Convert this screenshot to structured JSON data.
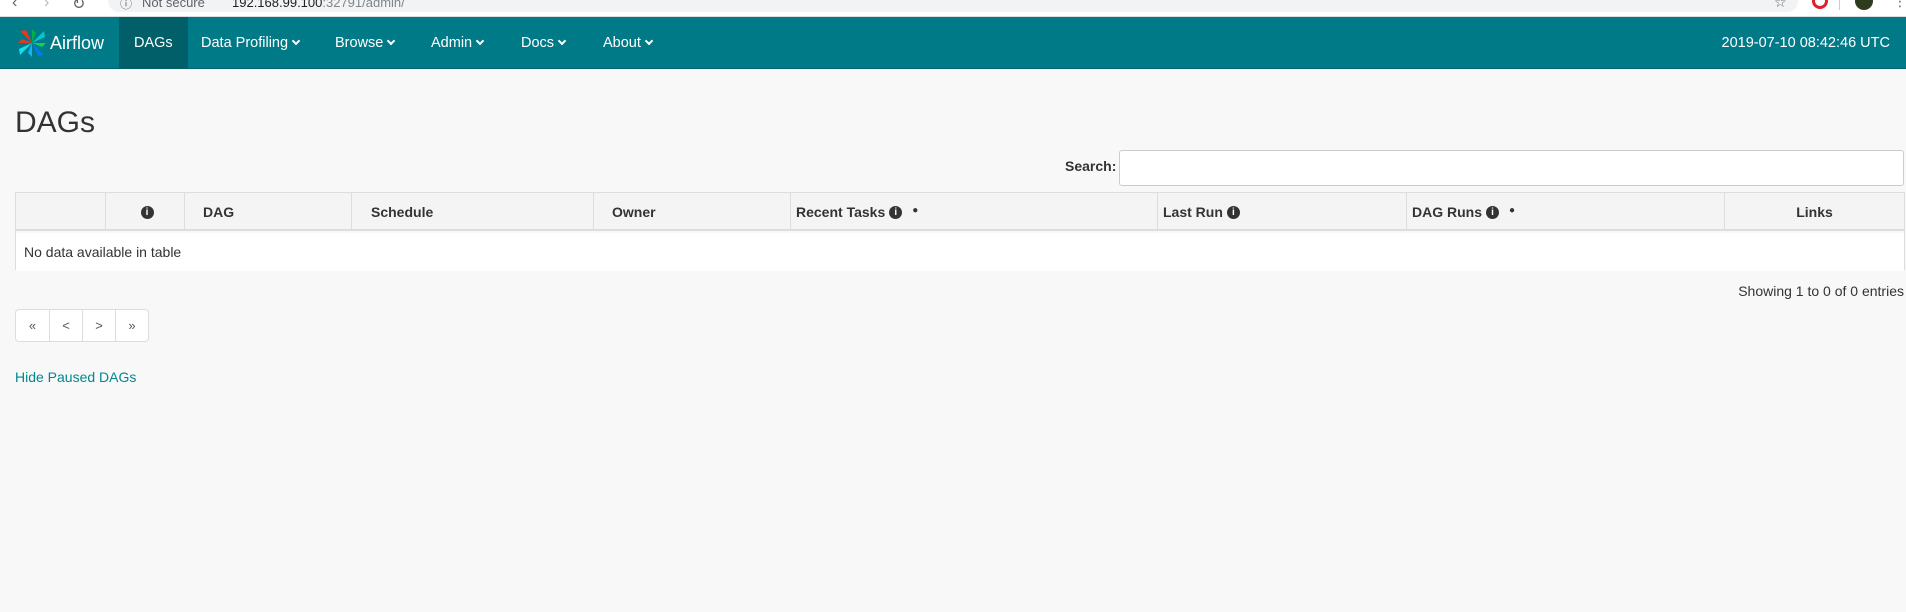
{
  "browser": {
    "security_label": "Not secure",
    "url_host": "192.168.99.100",
    "url_path": ":32791/admin/"
  },
  "navbar": {
    "brand": "Airflow",
    "items": [
      {
        "label": "DAGs",
        "active": true,
        "dropdown": false
      },
      {
        "label": "Data Profiling",
        "active": false,
        "dropdown": true
      },
      {
        "label": "Browse",
        "active": false,
        "dropdown": true
      },
      {
        "label": "Admin",
        "active": false,
        "dropdown": true
      },
      {
        "label": "Docs",
        "active": false,
        "dropdown": true
      },
      {
        "label": "About",
        "active": false,
        "dropdown": true
      }
    ],
    "clock": "2019-07-10 08:42:46 UTC",
    "bg_color": "#007a87"
  },
  "page": {
    "title": "DAGs",
    "search_label": "Search:",
    "search_value": "",
    "columns": [
      "",
      "",
      "DAG",
      "Schedule",
      "Owner",
      "Recent Tasks",
      "Last Run",
      "DAG Runs",
      "Links"
    ],
    "empty_message": "No data available in table",
    "showing": "Showing 1 to 0 of 0 entries",
    "pager": [
      "«",
      "<",
      ">",
      "»"
    ],
    "hide_paused": "Hide Paused DAGs"
  }
}
